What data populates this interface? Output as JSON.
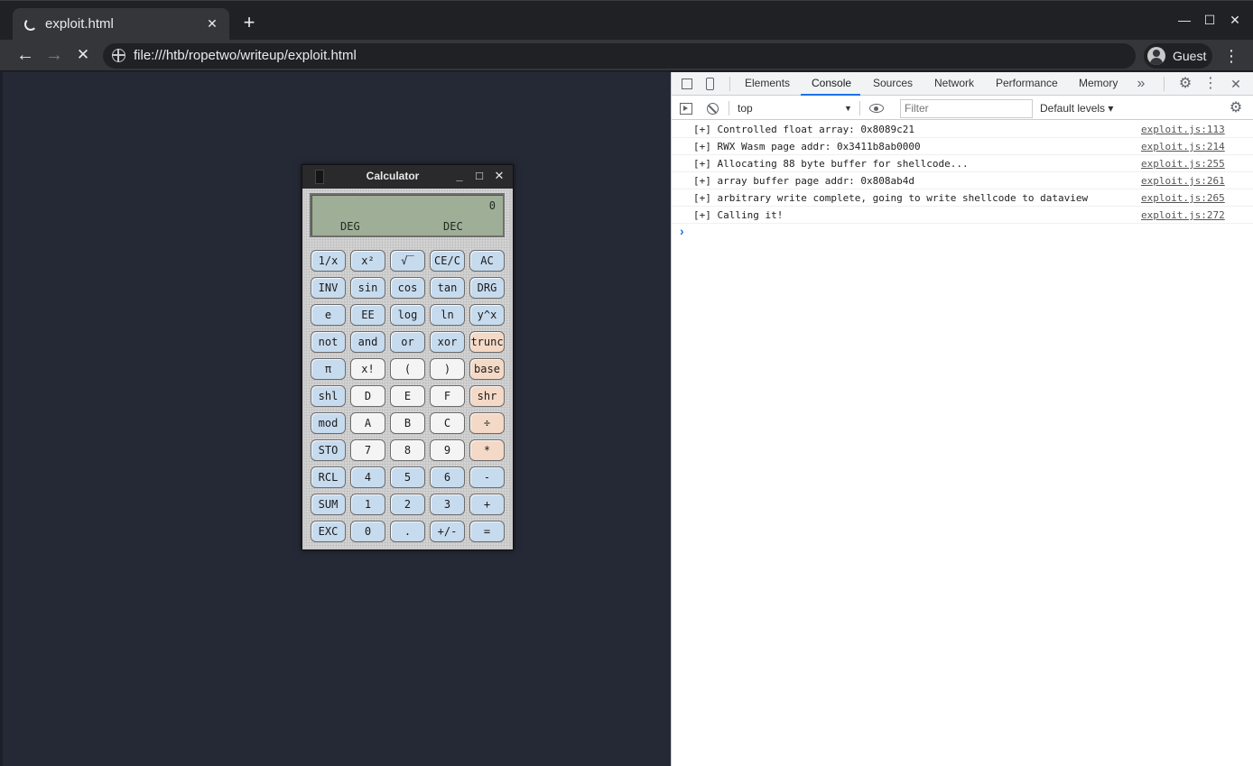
{
  "browser": {
    "tab_title": "exploit.html",
    "tab_close": "✕",
    "new_tab": "+",
    "url": "file:///htb/ropetwo/writeup/exploit.html",
    "profile_name": "Guest",
    "back_icon": "←",
    "forward_icon": "→",
    "stop_icon": "✕",
    "menu_icon": "⋮",
    "win_min": "—",
    "win_max": "☐",
    "win_close": "✕"
  },
  "calculator": {
    "title": "Calculator",
    "btn_min": "_",
    "btn_max": "□",
    "btn_close": "✕",
    "display": {
      "value": "0",
      "angle_mode": "DEG",
      "base_mode": "DEC"
    },
    "keys": [
      [
        "1/x",
        "x²",
        "√‾",
        "CE/C",
        "AC"
      ],
      [
        "INV",
        "sin",
        "cos",
        "tan",
        "DRG"
      ],
      [
        "e",
        "EE",
        "log",
        "ln",
        "y^x"
      ],
      [
        "not",
        "and",
        "or",
        "xor",
        "trunc"
      ],
      [
        "π",
        "x!",
        "(",
        ")",
        "base"
      ],
      [
        "shl",
        "D",
        "E",
        "F",
        "shr"
      ],
      [
        "mod",
        "A",
        "B",
        "C",
        "÷"
      ],
      [
        "STO",
        "7",
        "8",
        "9",
        "*"
      ],
      [
        "RCL",
        "4",
        "5",
        "6",
        "-"
      ],
      [
        "SUM",
        "1",
        "2",
        "3",
        "+"
      ],
      [
        "EXC",
        "0",
        ".",
        "+/-",
        "="
      ]
    ],
    "key_colors": [
      [
        "blue",
        "blue",
        "blue",
        "blue",
        "blue"
      ],
      [
        "blue",
        "blue",
        "blue",
        "blue",
        "blue"
      ],
      [
        "blue",
        "blue",
        "blue",
        "blue",
        "blue"
      ],
      [
        "blue",
        "blue",
        "blue",
        "blue",
        "peach"
      ],
      [
        "blue",
        "white",
        "white",
        "white",
        "peach"
      ],
      [
        "blue",
        "white",
        "white",
        "white",
        "peach"
      ],
      [
        "blue",
        "white",
        "white",
        "white",
        "peach"
      ],
      [
        "blue",
        "white",
        "white",
        "white",
        "peach"
      ],
      [
        "blue",
        "blue",
        "blue",
        "blue",
        "blue"
      ],
      [
        "blue",
        "blue",
        "blue",
        "blue",
        "blue"
      ],
      [
        "blue",
        "blue",
        "blue",
        "blue",
        "blue"
      ]
    ]
  },
  "devtools": {
    "tabs": [
      "Elements",
      "Console",
      "Sources",
      "Network",
      "Performance",
      "Memory"
    ],
    "active_tab": "Console",
    "more_tabs": "»",
    "settings_icon": "⚙",
    "menu_icon": "⋮",
    "close_icon": "✕",
    "context": "top",
    "context_caret": "▼",
    "filter_placeholder": "Filter",
    "levels": "Default levels ▾",
    "console_settings_icon": "⚙",
    "prompt": "›",
    "messages": [
      {
        "text": "[+] Controlled float array: 0x8089c21",
        "source": "exploit.js:113"
      },
      {
        "text": "[+] RWX Wasm page addr: 0x3411b8ab0000",
        "source": "exploit.js:214"
      },
      {
        "text": "[+] Allocating 88 byte buffer for shellcode...",
        "source": "exploit.js:255"
      },
      {
        "text": "[+] array buffer page addr: 0x808ab4d",
        "source": "exploit.js:261"
      },
      {
        "text": "[+] arbitrary write complete, going to write shellcode to dataview",
        "source": "exploit.js:265"
      },
      {
        "text": "[+] Calling it!",
        "source": "exploit.js:272"
      }
    ]
  },
  "colors": {
    "page_bg": "#252936",
    "chrome_dark": "#202124",
    "chrome_toolbar": "#35363a",
    "devtools_accent": "#1a73e8",
    "lcd": "#9fae97"
  }
}
